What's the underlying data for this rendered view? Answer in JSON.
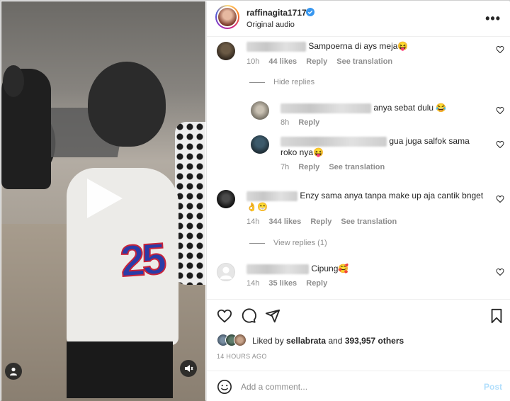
{
  "post": {
    "username": "raffinagita1717",
    "subtitle": "Original audio",
    "more_label": "•••"
  },
  "comments": [
    {
      "text": "Sampoerna di ays meja😝",
      "time": "10h",
      "likes": "44 likes",
      "reply": "Reply",
      "translate": "See translation"
    },
    {
      "type": "toggle",
      "label": "Hide replies"
    },
    {
      "text": "anya sebat dulu 😂",
      "time": "8h",
      "reply": "Reply"
    },
    {
      "text_line1": "gua juga salfok sama",
      "text_line2": "roko nya😝",
      "time": "7h",
      "reply": "Reply",
      "translate": "See translation"
    },
    {
      "text_line1": "Enzy sama anya tanpa make up aja cantik bnget",
      "text_line2": "👌😁",
      "time": "14h",
      "likes": "344 likes",
      "reply": "Reply",
      "translate": "See translation"
    },
    {
      "type": "toggle",
      "label": "View replies (1)"
    },
    {
      "text": "Cipung🥰",
      "time": "14h",
      "likes": "35 likes",
      "reply": "Reply"
    }
  ],
  "likes": {
    "prefix": "Liked by",
    "user": "sellabrata",
    "and": "and",
    "count": "393,957 others"
  },
  "timestamp": "14 HOURS AGO",
  "composer": {
    "placeholder": "Add a comment...",
    "post_label": "Post"
  },
  "icons": {
    "actions": [
      "heart-icon",
      "comment-icon",
      "share-icon",
      "bookmark-icon"
    ],
    "video": [
      "play-icon",
      "user-tag-icon",
      "volume-icon"
    ],
    "post_button_color": "#b2dffc",
    "verified_color": "#3897f0"
  }
}
